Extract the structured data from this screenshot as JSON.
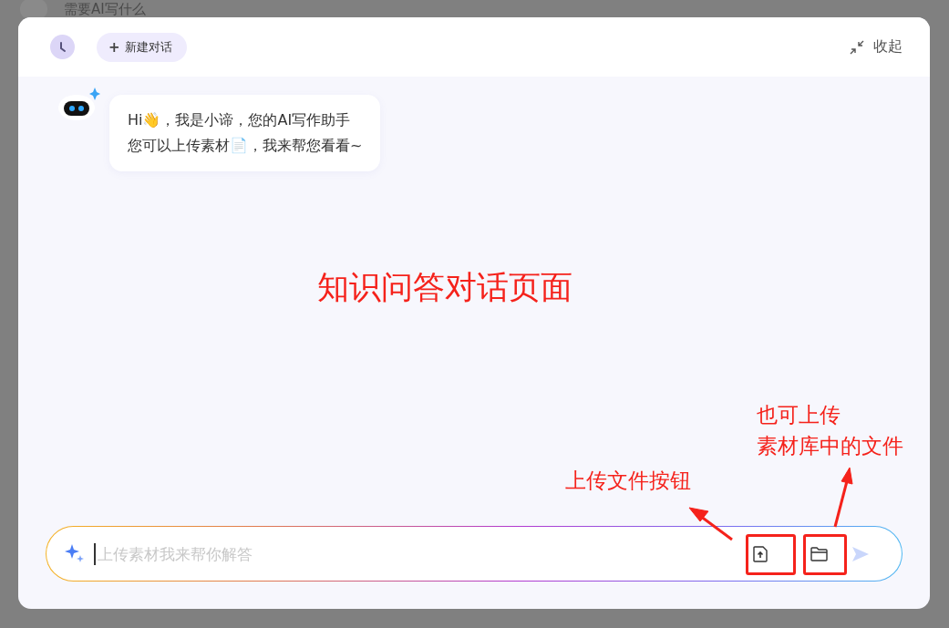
{
  "background_page": {
    "prompt": "需要AI写什么"
  },
  "dialog": {
    "header": {
      "new_chat_button": {
        "icon": "+",
        "label": "新建对话"
      },
      "collapse_button": {
        "label": "收起"
      }
    },
    "messages": [
      {
        "lines": [
          "Hi👋，我是小谛，您的AI写作助手",
          "您可以上传素材📄，我来帮您看看~"
        ]
      }
    ],
    "input": {
      "placeholder": "上传素材我来帮你解答"
    }
  },
  "annotations": {
    "title": "知识问答对话页面",
    "upload_note": "上传文件按钮",
    "library_note": [
      "也可上传",
      "素材库中的文件"
    ]
  }
}
